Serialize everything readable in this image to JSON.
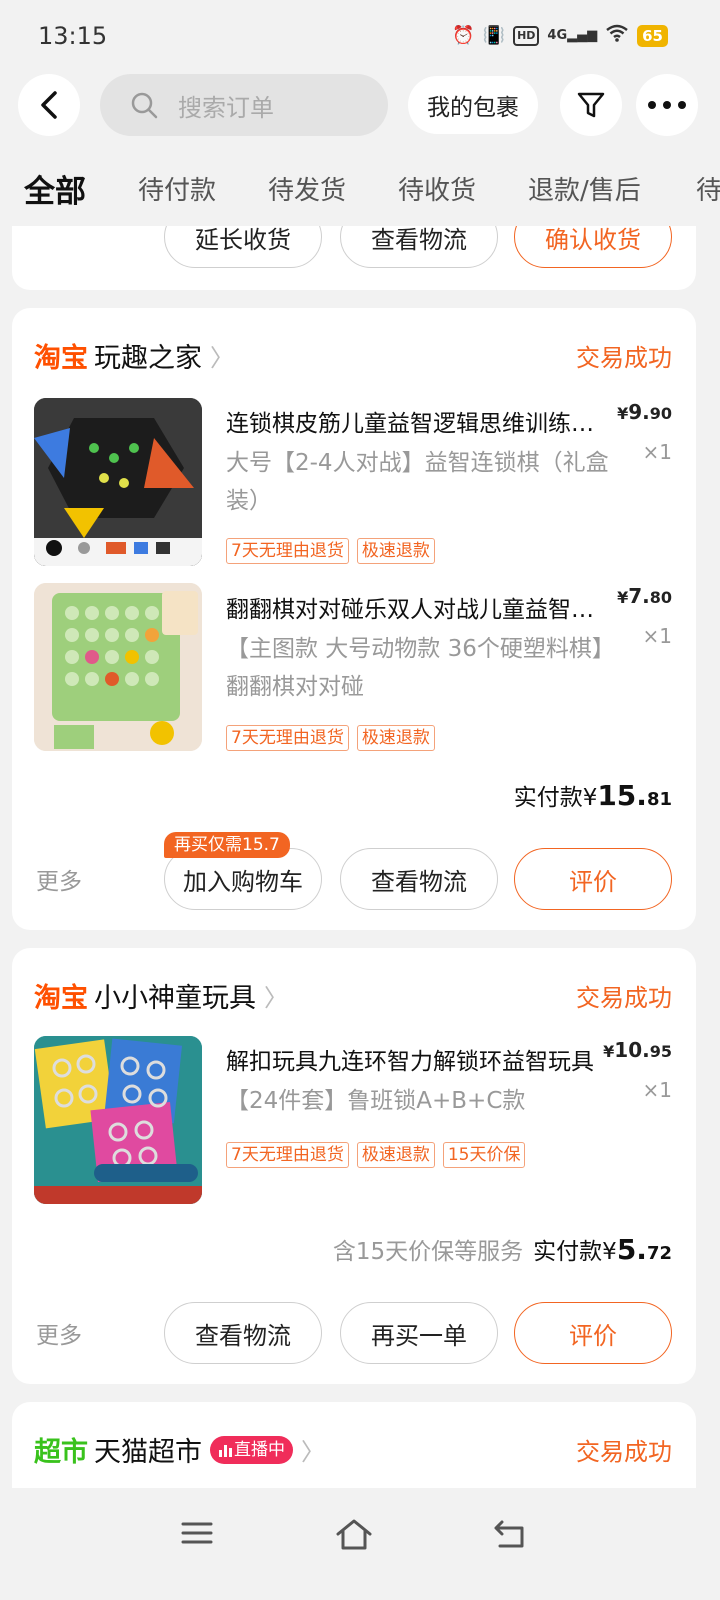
{
  "status_bar": {
    "time": "13:15",
    "hd": "HD",
    "network": "4G",
    "battery": "65"
  },
  "header": {
    "back_icon": "back-arrow-icon",
    "search_placeholder": "搜索订单",
    "my_packages": "我的包裹",
    "filter_icon": "filter-icon",
    "more_icon": "more-dots-icon"
  },
  "tabs": [
    "全部",
    "待付款",
    "待发货",
    "待收货",
    "退款/售后",
    "待"
  ],
  "top_card": {
    "buttons": [
      "延长收货",
      "查看物流",
      "确认收货"
    ]
  },
  "order1": {
    "brand": "淘宝",
    "brand_color": "#ff5000",
    "shop": "玩趣之家",
    "status": "交易成功",
    "items": [
      {
        "title": "连锁棋皮筋儿童益智逻辑思维训练玩具",
        "spec": "大号【2-4人对战】益智连锁棋（礼盒装）",
        "tags": [
          "7天无理由退货",
          "极速退款"
        ],
        "price_int": "9.",
        "price_dec": "90",
        "qty": "×1",
        "currency": "¥"
      },
      {
        "title": "翻翻棋对对碰乐双人对战儿童益智桌游",
        "spec": "【主图款 大号动物款 36个硬塑料棋】翻翻棋对对碰",
        "tags": [
          "7天无理由退货",
          "极速退款"
        ],
        "price_int": "7.",
        "price_dec": "80",
        "qty": "×1",
        "currency": "¥"
      }
    ],
    "paid_label": "实付款",
    "currency": "¥",
    "paid_int": "15.",
    "paid_dec": "81",
    "more": "更多",
    "rebuy_badge": "再买仅需15.7",
    "buttons": [
      "加入购物车",
      "查看物流",
      "评价"
    ]
  },
  "order2": {
    "brand": "淘宝",
    "brand_color": "#ff5000",
    "shop": "小小神童玩具",
    "status": "交易成功",
    "items": [
      {
        "title": "解扣玩具九连环智力解锁环益智玩具",
        "spec": "【24件套】鲁班锁A+B+C款",
        "tags": [
          "7天无理由退货",
          "极速退款",
          "15天价保"
        ],
        "price_int": "10.",
        "price_dec": "95",
        "qty": "×1",
        "currency": "¥"
      }
    ],
    "service_note": "含15天价保等服务",
    "paid_label": "实付款",
    "currency": "¥",
    "paid_int": "5.",
    "paid_dec": "72",
    "more": "更多",
    "buttons": [
      "查看物流",
      "再买一单",
      "评价"
    ]
  },
  "order3": {
    "brand": "超市",
    "brand_color": "#39c21c",
    "shop": "天猫超市",
    "live_badge": "直播中",
    "status": "交易成功"
  },
  "navbar": {
    "icons": [
      "menu-icon",
      "home-icon",
      "back-icon"
    ]
  }
}
